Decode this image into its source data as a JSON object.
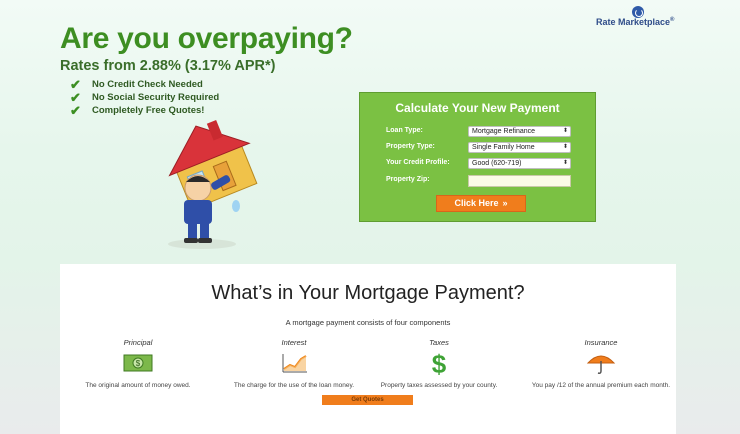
{
  "logo": {
    "text": "Rate Marketplace",
    "registered": "®"
  },
  "hero": {
    "headline": "Are you overpaying?",
    "rates": "Rates from 2.88% (3.17% APR*)",
    "checks": [
      "No Credit Check Needed",
      "No Social Security Required",
      "Completely Free Quotes!"
    ]
  },
  "calculator": {
    "title": "Calculate Your New Payment",
    "fields": [
      {
        "label": "Loan Type:",
        "value": "Mortgage Refinance"
      },
      {
        "label": "Property Type:",
        "value": "Single Family Home"
      },
      {
        "label": "Your Credit Profile:",
        "value": "Good (620-719)"
      }
    ],
    "zip_label": "Property Zip:",
    "zip_value": "",
    "button_label": "Click Here",
    "button_chevron": "»"
  },
  "info": {
    "title": "What’s in Your Mortgage Payment?",
    "subtitle": "A mortgage payment consists of four components",
    "components": [
      {
        "title": "Principal",
        "icon": "money-bill-icon",
        "desc": "The original amount of money owed."
      },
      {
        "title": "Interest",
        "icon": "chart-icon",
        "desc": "The charge for the use of the loan money."
      },
      {
        "title": "Taxes",
        "icon": "dollar-sign-icon",
        "desc": "Property taxes assessed by your county."
      },
      {
        "title": "Insurance",
        "icon": "umbrella-icon",
        "desc": "You pay /12 of the annual premium each month."
      }
    ],
    "button_label": "Get Quotes"
  },
  "colors": {
    "headline_green": "#3d8e22",
    "panel_green": "#7bc143",
    "button_orange": "#f07d1c",
    "logo_blue": "#2f4c89"
  }
}
